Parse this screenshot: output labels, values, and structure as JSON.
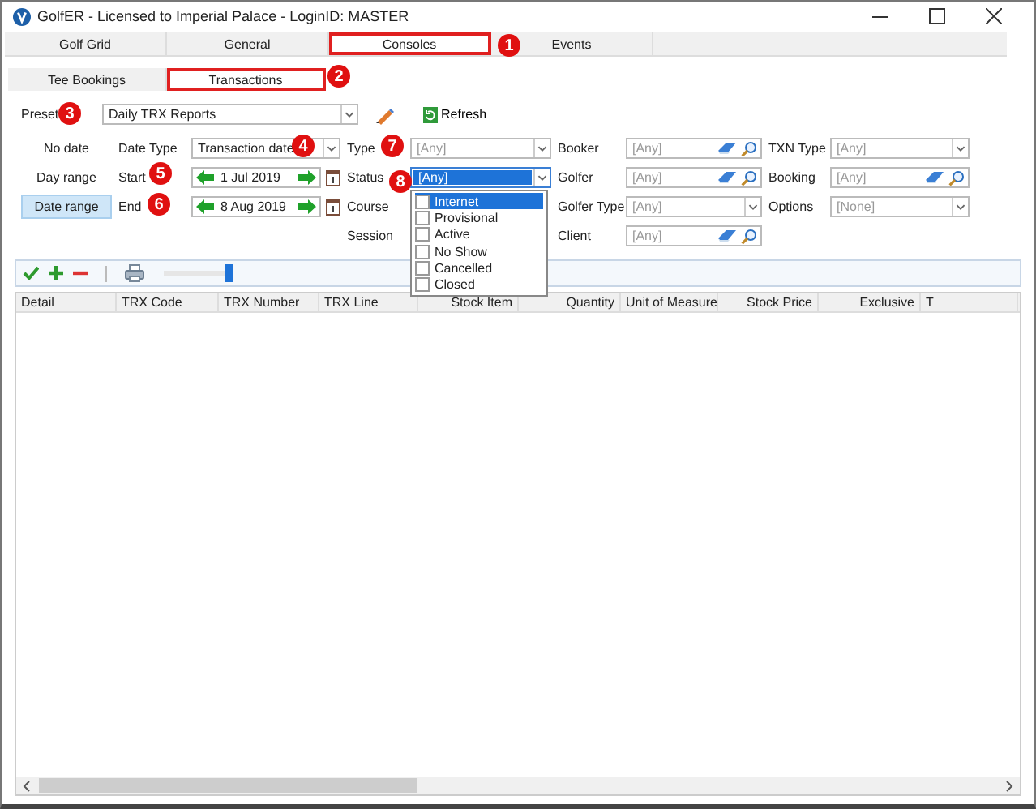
{
  "window": {
    "title": "GolfER - Licensed to Imperial Palace - LoginID: MASTER"
  },
  "main_tabs": [
    {
      "label": "Golf Grid",
      "selected": false,
      "highlighted": false
    },
    {
      "label": "General",
      "selected": false,
      "highlighted": false
    },
    {
      "label": "Consoles",
      "selected": true,
      "highlighted": true
    },
    {
      "label": "Events",
      "selected": false,
      "highlighted": false
    }
  ],
  "sub_tabs": [
    {
      "label": "Tee Bookings",
      "selected": false,
      "highlighted": false
    },
    {
      "label": "Transactions",
      "selected": true,
      "highlighted": true
    }
  ],
  "preset": {
    "label": "Preset",
    "value": "Daily TRX Reports",
    "refresh": "Refresh"
  },
  "date_modes": [
    {
      "label": "No date",
      "selected": false
    },
    {
      "label": "Day range",
      "selected": false
    },
    {
      "label": "Date range",
      "selected": true
    }
  ],
  "filter_columns": [
    [
      {
        "label": "Date Type",
        "kind": "combo",
        "value": "Transaction date",
        "disabled": false
      },
      {
        "label": "Start",
        "kind": "date",
        "value": "1 Jul 2019"
      },
      {
        "label": "End",
        "kind": "date",
        "value": "8 Aug 2019"
      }
    ],
    [
      {
        "label": "Type",
        "kind": "combo",
        "value": "[Any]",
        "disabled": true
      },
      {
        "label": "Status",
        "kind": "combo",
        "value": "[Any]",
        "disabled": false,
        "open": true
      },
      {
        "label": "Course",
        "kind": "covered"
      },
      {
        "label": "Session",
        "kind": "covered"
      }
    ],
    [
      {
        "label": "Booker",
        "kind": "lookup",
        "value": "[Any]"
      },
      {
        "label": "Golfer",
        "kind": "lookup",
        "value": "[Any]"
      },
      {
        "label": "Golfer Type",
        "kind": "combo",
        "value": "[Any]",
        "disabled": true
      },
      {
        "label": "Client",
        "kind": "lookup",
        "value": "[Any]"
      }
    ],
    [
      {
        "label": "TXN Type",
        "kind": "combo",
        "value": "[Any]",
        "disabled": true
      },
      {
        "label": "Booking",
        "kind": "lookup",
        "value": "[Any]"
      },
      {
        "label": "Options",
        "kind": "combo",
        "value": "[None]",
        "disabled": true
      }
    ]
  ],
  "status_options": [
    {
      "label": "Internet",
      "checked": false,
      "selected": true
    },
    {
      "label": "Provisional",
      "checked": false,
      "selected": false
    },
    {
      "label": "Active",
      "checked": false,
      "selected": false
    },
    {
      "label": "No Show",
      "checked": false,
      "selected": false
    },
    {
      "label": "Cancelled",
      "checked": false,
      "selected": false
    },
    {
      "label": "Closed",
      "checked": false,
      "selected": false
    }
  ],
  "toolbar": {
    "zoom": {
      "level": 1
    }
  },
  "table": {
    "columns": [
      "Detail",
      "TRX Code",
      "TRX Number",
      "TRX Line",
      "Stock Item",
      "Quantity",
      "Unit of Measure",
      "Stock Price",
      "Exclusive",
      "T"
    ]
  },
  "callouts": [
    {
      "number": "1"
    },
    {
      "number": "2"
    },
    {
      "number": "3"
    },
    {
      "number": "4"
    },
    {
      "number": "5"
    },
    {
      "number": "6"
    },
    {
      "number": "7"
    },
    {
      "number": "8"
    }
  ]
}
